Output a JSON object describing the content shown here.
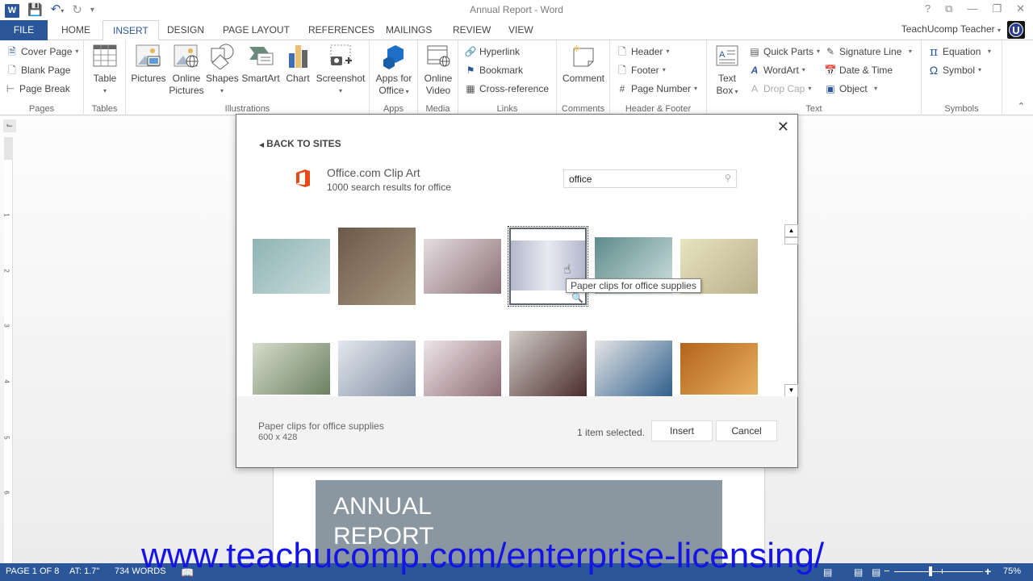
{
  "window": {
    "title": "Annual Report - Word",
    "controls": [
      "?",
      "⧉",
      "—",
      "❐",
      "✕"
    ]
  },
  "tabs": [
    {
      "label": "FILE"
    },
    {
      "label": "HOME"
    },
    {
      "label": "INSERT",
      "active": true
    },
    {
      "label": "DESIGN"
    },
    {
      "label": "PAGE LAYOUT"
    },
    {
      "label": "REFERENCES"
    },
    {
      "label": "MAILINGS"
    },
    {
      "label": "REVIEW"
    },
    {
      "label": "VIEW"
    }
  ],
  "user": {
    "name": "TeachUcomp Teacher",
    "avatar_letter": "U"
  },
  "ribbon": {
    "pages": {
      "label": "Pages",
      "cover_page": "Cover Page",
      "blank_page": "Blank Page",
      "page_break": "Page Break"
    },
    "tables": {
      "label": "Tables",
      "table": "Table"
    },
    "illustrations": {
      "label": "Illustrations",
      "pictures": "Pictures",
      "online_pictures_1": "Online",
      "online_pictures_2": "Pictures",
      "shapes": "Shapes",
      "smartart": "SmartArt",
      "chart": "Chart",
      "screenshot": "Screenshot"
    },
    "apps": {
      "label": "Apps",
      "apps_1": "Apps for",
      "apps_2": "Office"
    },
    "media": {
      "label": "Media",
      "video_1": "Online",
      "video_2": "Video"
    },
    "links": {
      "label": "Links",
      "hyperlink": "Hyperlink",
      "bookmark": "Bookmark",
      "cross_reference": "Cross-reference"
    },
    "comments": {
      "label": "Comments",
      "comment": "Comment"
    },
    "header_footer": {
      "label": "Header & Footer",
      "header": "Header",
      "footer": "Footer",
      "page_number": "Page Number"
    },
    "text": {
      "label": "Text",
      "text_box_1": "Text",
      "text_box_2": "Box",
      "quick_parts": "Quick Parts",
      "wordart": "WordArt",
      "drop_cap": "Drop Cap",
      "signature_line": "Signature Line",
      "date_time": "Date & Time",
      "object": "Object"
    },
    "symbols": {
      "label": "Symbols",
      "equation": "Equation",
      "symbol": "Symbol"
    }
  },
  "dialog": {
    "back_label": "BACK TO SITES",
    "source_title": "Office.com Clip Art",
    "source_subtitle": "1000 search results for office",
    "search_value": "office",
    "tooltip": "Paper clips for office supplies",
    "results": [
      {
        "name": "paper-airplane",
        "colors": [
          "#8fb3b4",
          "#c9dcdc"
        ]
      },
      {
        "name": "man-at-desk",
        "colors": [
          "#6b5a48",
          "#a79880"
        ]
      },
      {
        "name": "pen-stand",
        "colors": [
          "#e6dde0",
          "#8a7076"
        ]
      },
      {
        "name": "paper-clip",
        "colors": [
          "#e8eaf1",
          "#b3b8cc"
        ],
        "selected": true
      },
      {
        "name": "push-pin-shadow",
        "colors": [
          "#5e8b8b",
          "#cfe0e0"
        ]
      },
      {
        "name": "binder-clip-yellow",
        "colors": [
          "#e8e3bf",
          "#b9b08a"
        ]
      },
      {
        "name": "binder-clip-green",
        "colors": [
          "#d6ddcc",
          "#6b8060"
        ]
      },
      {
        "name": "scissors",
        "colors": [
          "#e3e8ef",
          "#7f8ca0"
        ]
      },
      {
        "name": "caliper",
        "colors": [
          "#efe5e8",
          "#8a6a72"
        ]
      },
      {
        "name": "laptop",
        "colors": [
          "#d3cec8",
          "#4a2c2c"
        ]
      },
      {
        "name": "person-at-office",
        "colors": [
          "#e5e5e5",
          "#2e5f8c"
        ]
      },
      {
        "name": "abacus",
        "colors": [
          "#b3641c",
          "#e8b060"
        ]
      }
    ],
    "selected_name": "Paper clips for office supplies",
    "selected_size": "600 x 428",
    "selected_count": "1 item selected.",
    "insert_label": "Insert",
    "cancel_label": "Cancel"
  },
  "document": {
    "cover_line1": "ANNUAL",
    "cover_line2": "REPORT",
    "ruler_numbers": [
      "1",
      "2",
      "3",
      "4",
      "5",
      "6"
    ]
  },
  "watermark": "www.teachucomp.com/enterprise-licensing/",
  "status": {
    "page": "PAGE 1 OF 8",
    "at": "AT: 1.7\"",
    "words": "734 WORDS",
    "zoom": "75%",
    "zoom_minus": "−",
    "zoom_plus": "+"
  },
  "colors": {
    "accent": "#2b579a",
    "office_logo": "#e64a19",
    "watermark": "#1414e6"
  }
}
